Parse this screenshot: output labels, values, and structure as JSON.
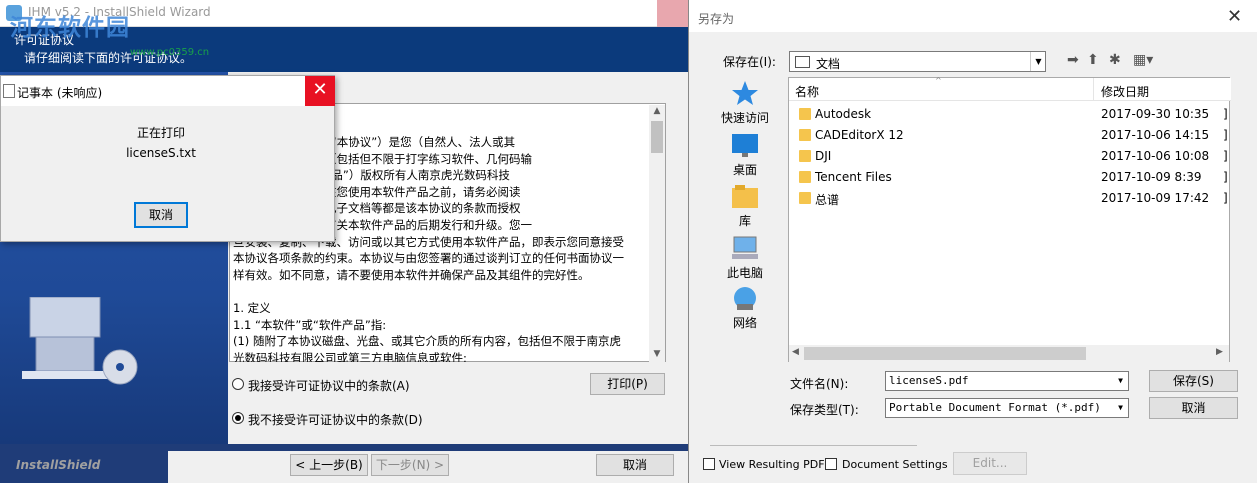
{
  "installer": {
    "title": "IHM v5.2 - InstallShield Wizard",
    "header_title": "许可证协议",
    "header_sub": "请仔细阅读下面的许可证协议。",
    "watermark": "河东软件园",
    "watermark_url": "www.pc0359.cn",
    "license_lines": [
      "许可协议》（以下称“本协议”）是您（自然人、法人或其",
      "的打字王软件产品（包括但不限于打字练习软件、几何码输",
      "“本软件”或“软件产品”）版权所有人南京虎光数码科技",
      "法律效力的协议。在您使用本软件产品之前，请务必阅读",
      "协议有关的软件、电子文档等都是该本协议的条款而授权",
      "协议亦适用于任何有关本软件产品的后期发行和升级。您一",
      "旦安装、复制、下载、访问或以其它方式使用本软件产品，即表示您同意接受",
      "本协议各项条款的约束。本协议与由您签署的通过谈判订立的任何书面协议一",
      "样有效。如不同意，请不要使用本软件并确保产品及其组件的完好性。",
      "",
      "1. 定义",
      "1.1 “本软件”或“软件产品”指:",
      "(1) 随附了本协议磁盘、光盘、或其它介质的所有内容，包括但不限于南京虎",
      "光数码科技有限公司或第三方电脑信息或软件;"
    ],
    "print_button": "打印(P)",
    "radio_accept": "我接受许可证协议中的条款(A)",
    "radio_decline": "我不接受许可证协议中的条款(D)",
    "brand": "InstallShield",
    "back_button": "< 上一步(B)",
    "next_button": "下一步(N) >",
    "cancel_button": "取消"
  },
  "notepad": {
    "title": "记事本 (未响应)",
    "status": "正在打印",
    "file": "licenseS.txt",
    "cancel_button": "取消"
  },
  "saveas": {
    "title": "另存为",
    "save_in_label": "保存在(I):",
    "save_in_value": "文档",
    "places": [
      {
        "label": "快速访问",
        "icon": "star-icon"
      },
      {
        "label": "桌面",
        "icon": "desktop-icon"
      },
      {
        "label": "库",
        "icon": "library-icon"
      },
      {
        "label": "此电脑",
        "icon": "computer-icon"
      },
      {
        "label": "网络",
        "icon": "network-icon"
      }
    ],
    "columns": [
      "名称",
      "修改日期"
    ],
    "files": [
      {
        "name": "Autodesk",
        "date": "2017-09-30 10:35",
        "extra": "]"
      },
      {
        "name": "CADEditorX 12",
        "date": "2017-10-06 14:15",
        "extra": "]"
      },
      {
        "name": "DJI",
        "date": "2017-10-06 10:08",
        "extra": "]"
      },
      {
        "name": "Tencent Files",
        "date": "2017-10-09 8:39",
        "extra": "]"
      },
      {
        "name": "总谱",
        "date": "2017-10-09 17:42",
        "extra": "]"
      }
    ],
    "filename_label": "文件名(N):",
    "filename_value": "licenseS.pdf",
    "filetype_label": "保存类型(T):",
    "filetype_value": "Portable Document Format (*.pdf)",
    "save_button": "保存(S)",
    "cancel_button": "取消",
    "view_pdf_label": "View Resulting PDF",
    "doc_settings_label": "Document Settings",
    "edit_button": "Edit..."
  }
}
